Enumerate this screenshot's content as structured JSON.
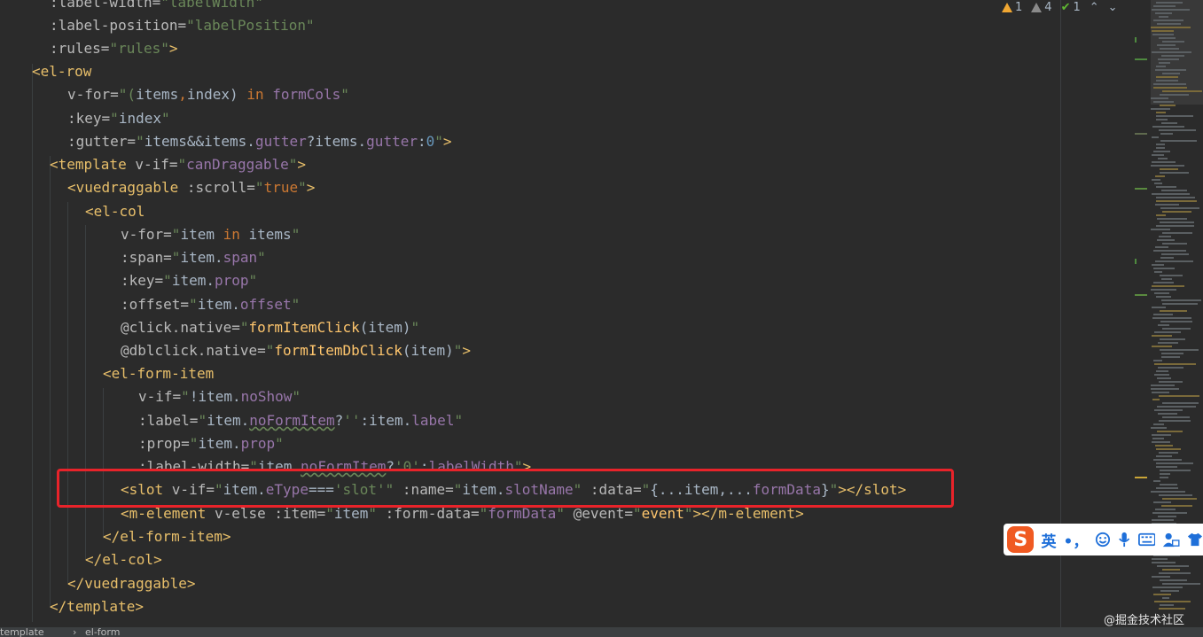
{
  "inspections": {
    "warnings": "1",
    "weak_warnings": "4",
    "ok": "1"
  },
  "code_lines": [
    [
      [
        "c-attr",
        ":label-width="
      ],
      [
        "c-str",
        "\"labelWidth\""
      ]
    ],
    [
      [
        "c-attr",
        ":label-position="
      ],
      [
        "c-str",
        "\"labelPosition\""
      ]
    ],
    [
      [
        "c-attr",
        ":rules="
      ],
      [
        "c-str",
        "\"rules\""
      ],
      [
        "c-tag",
        ">"
      ]
    ],
    [
      [
        "c-tag",
        "<el-row"
      ]
    ],
    [
      [
        "c-attr",
        "v-for="
      ],
      [
        "c-str",
        "\"("
      ],
      [
        "c-br",
        "items"
      ],
      [
        "c-kw",
        ","
      ],
      [
        "c-br",
        "index) "
      ],
      [
        "c-kw",
        "in "
      ],
      [
        "c-prop",
        "formCols"
      ],
      [
        "c-str",
        "\""
      ]
    ],
    [
      [
        "c-attr",
        ":key="
      ],
      [
        "c-str",
        "\""
      ],
      [
        "c-br",
        "index"
      ],
      [
        "c-str",
        "\""
      ]
    ],
    [
      [
        "c-attr",
        ":gutter="
      ],
      [
        "c-str",
        "\""
      ],
      [
        "c-br",
        "items&&items."
      ],
      [
        "c-prop",
        "gutter"
      ],
      [
        "c-br",
        "?items."
      ],
      [
        "c-prop",
        "gutter"
      ],
      [
        "c-br",
        ":"
      ],
      [
        "c-num",
        "0"
      ],
      [
        "c-str",
        "\""
      ],
      [
        "c-tag",
        ">"
      ]
    ],
    [
      [
        "c-tag",
        "<template "
      ],
      [
        "c-attr",
        "v-if="
      ],
      [
        "c-str",
        "\""
      ],
      [
        "c-prop",
        "canDraggable"
      ],
      [
        "c-str",
        "\""
      ],
      [
        "c-tag",
        ">"
      ]
    ],
    [
      [
        "c-tag",
        "<vuedraggable "
      ],
      [
        "c-attr",
        ":scroll="
      ],
      [
        "c-str",
        "\""
      ],
      [
        "c-kw",
        "true"
      ],
      [
        "c-str",
        "\""
      ],
      [
        "c-tag",
        ">"
      ]
    ],
    [
      [
        "c-tag",
        "<el-col"
      ]
    ],
    [
      [
        "c-attr",
        "v-for="
      ],
      [
        "c-str",
        "\""
      ],
      [
        "c-br",
        "item "
      ],
      [
        "c-kw",
        "in "
      ],
      [
        "c-br",
        "items"
      ],
      [
        "c-str",
        "\""
      ]
    ],
    [
      [
        "c-attr",
        ":span="
      ],
      [
        "c-str",
        "\""
      ],
      [
        "c-br",
        "item."
      ],
      [
        "c-prop",
        "span"
      ],
      [
        "c-str",
        "\""
      ]
    ],
    [
      [
        "c-attr",
        ":key="
      ],
      [
        "c-str",
        "\""
      ],
      [
        "c-br",
        "item."
      ],
      [
        "c-prop",
        "prop"
      ],
      [
        "c-str",
        "\""
      ]
    ],
    [
      [
        "c-attr",
        ":offset="
      ],
      [
        "c-str",
        "\""
      ],
      [
        "c-br",
        "item."
      ],
      [
        "c-prop",
        "offset"
      ],
      [
        "c-str",
        "\""
      ]
    ],
    [
      [
        "c-attr",
        "@click.native="
      ],
      [
        "c-str",
        "\""
      ],
      [
        "c-fn",
        "formItemClick"
      ],
      [
        "c-br",
        "(item)"
      ],
      [
        "c-str",
        "\""
      ]
    ],
    [
      [
        "c-attr",
        "@dblclick.native="
      ],
      [
        "c-str",
        "\""
      ],
      [
        "c-fn",
        "formItemDbClick"
      ],
      [
        "c-br",
        "(item)"
      ],
      [
        "c-str",
        "\""
      ],
      [
        "c-tag",
        ">"
      ]
    ],
    [
      [
        "c-tag",
        "<el-form-item"
      ]
    ],
    [
      [
        "c-attr",
        "v-if="
      ],
      [
        "c-str",
        "\""
      ],
      [
        "c-br",
        "!item."
      ],
      [
        "c-prop",
        "noShow"
      ],
      [
        "c-str",
        "\""
      ]
    ],
    [
      [
        "c-attr",
        ":label="
      ],
      [
        "c-str",
        "\""
      ],
      [
        "c-br",
        "item."
      ],
      [
        "c-prop c-wavy",
        "noFormItem"
      ],
      [
        "c-br",
        "?"
      ],
      [
        "c-str",
        "''"
      ],
      [
        "c-br",
        ":item."
      ],
      [
        "c-prop",
        "label"
      ],
      [
        "c-str",
        "\""
      ]
    ],
    [
      [
        "c-attr",
        ":prop="
      ],
      [
        "c-str",
        "\""
      ],
      [
        "c-br",
        "item."
      ],
      [
        "c-prop",
        "prop"
      ],
      [
        "c-str",
        "\""
      ]
    ],
    [
      [
        "c-attr",
        ":label-width="
      ],
      [
        "c-str",
        "\""
      ],
      [
        "c-br",
        "item."
      ],
      [
        "c-prop c-wavy",
        "noFormItem"
      ],
      [
        "c-br",
        "?"
      ],
      [
        "c-str",
        "'0'"
      ],
      [
        "c-br",
        ":"
      ],
      [
        "c-prop",
        "labelWidth"
      ],
      [
        "c-str",
        "\""
      ],
      [
        "c-tag",
        ">"
      ]
    ],
    [
      [
        "c-tag",
        "<slot "
      ],
      [
        "c-attr",
        "v-if="
      ],
      [
        "c-str",
        "\""
      ],
      [
        "c-br",
        "item."
      ],
      [
        "c-prop",
        "eType"
      ],
      [
        "c-br",
        "==="
      ],
      [
        "c-str",
        "'slot'\" "
      ],
      [
        "c-attr",
        ":name="
      ],
      [
        "c-str",
        "\""
      ],
      [
        "c-br",
        "item."
      ],
      [
        "c-prop",
        "slotName"
      ],
      [
        "c-str",
        "\" "
      ],
      [
        "c-attr",
        ":data="
      ],
      [
        "c-str",
        "\""
      ],
      [
        "c-br",
        "{...item,..."
      ],
      [
        "c-prop",
        "formData"
      ],
      [
        "c-br",
        "}"
      ],
      [
        "c-str",
        "\""
      ],
      [
        "c-tag",
        "></slot>"
      ]
    ],
    [
      [
        "c-tag",
        "<m-element "
      ],
      [
        "c-attr",
        "v-else "
      ],
      [
        "c-attr",
        ":item="
      ],
      [
        "c-str",
        "\""
      ],
      [
        "c-br",
        "item"
      ],
      [
        "c-str",
        "\" "
      ],
      [
        "c-attr",
        ":form-data="
      ],
      [
        "c-str",
        "\""
      ],
      [
        "c-prop",
        "formData"
      ],
      [
        "c-str",
        "\" "
      ],
      [
        "c-attr",
        "@event="
      ],
      [
        "c-str",
        "\""
      ],
      [
        "c-fn",
        "event"
      ],
      [
        "c-str",
        "\""
      ],
      [
        "c-tag",
        "></m-element>"
      ]
    ],
    [
      [
        "c-tag",
        "</el-form-item>"
      ]
    ],
    [
      [
        "c-tag",
        "</el-col>"
      ]
    ],
    [
      [
        "c-tag",
        "</vuedraggable>"
      ]
    ],
    [
      [
        "c-tag",
        "</template>"
      ]
    ]
  ],
  "status": {
    "breadcrumb_1": "template",
    "breadcrumb_2": "el-form"
  },
  "ime": {
    "logo": "S",
    "lang": "英",
    "punct": "•，"
  },
  "watermark": "@掘金技术社区",
  "colors": {
    "background": "#2b2b2b",
    "highlight_box": "#e8232a",
    "tag": "#e8bf6a",
    "string": "#6a8759",
    "keyword": "#cc7832",
    "property": "#9876aa"
  },
  "icons": [
    "warning-icon",
    "weak-warning-icon",
    "check-icon",
    "arrow-up-icon",
    "arrow-down-icon",
    "microphone-icon",
    "keyboard-icon",
    "smiley-icon",
    "shirt-icon",
    "user-icon"
  ]
}
